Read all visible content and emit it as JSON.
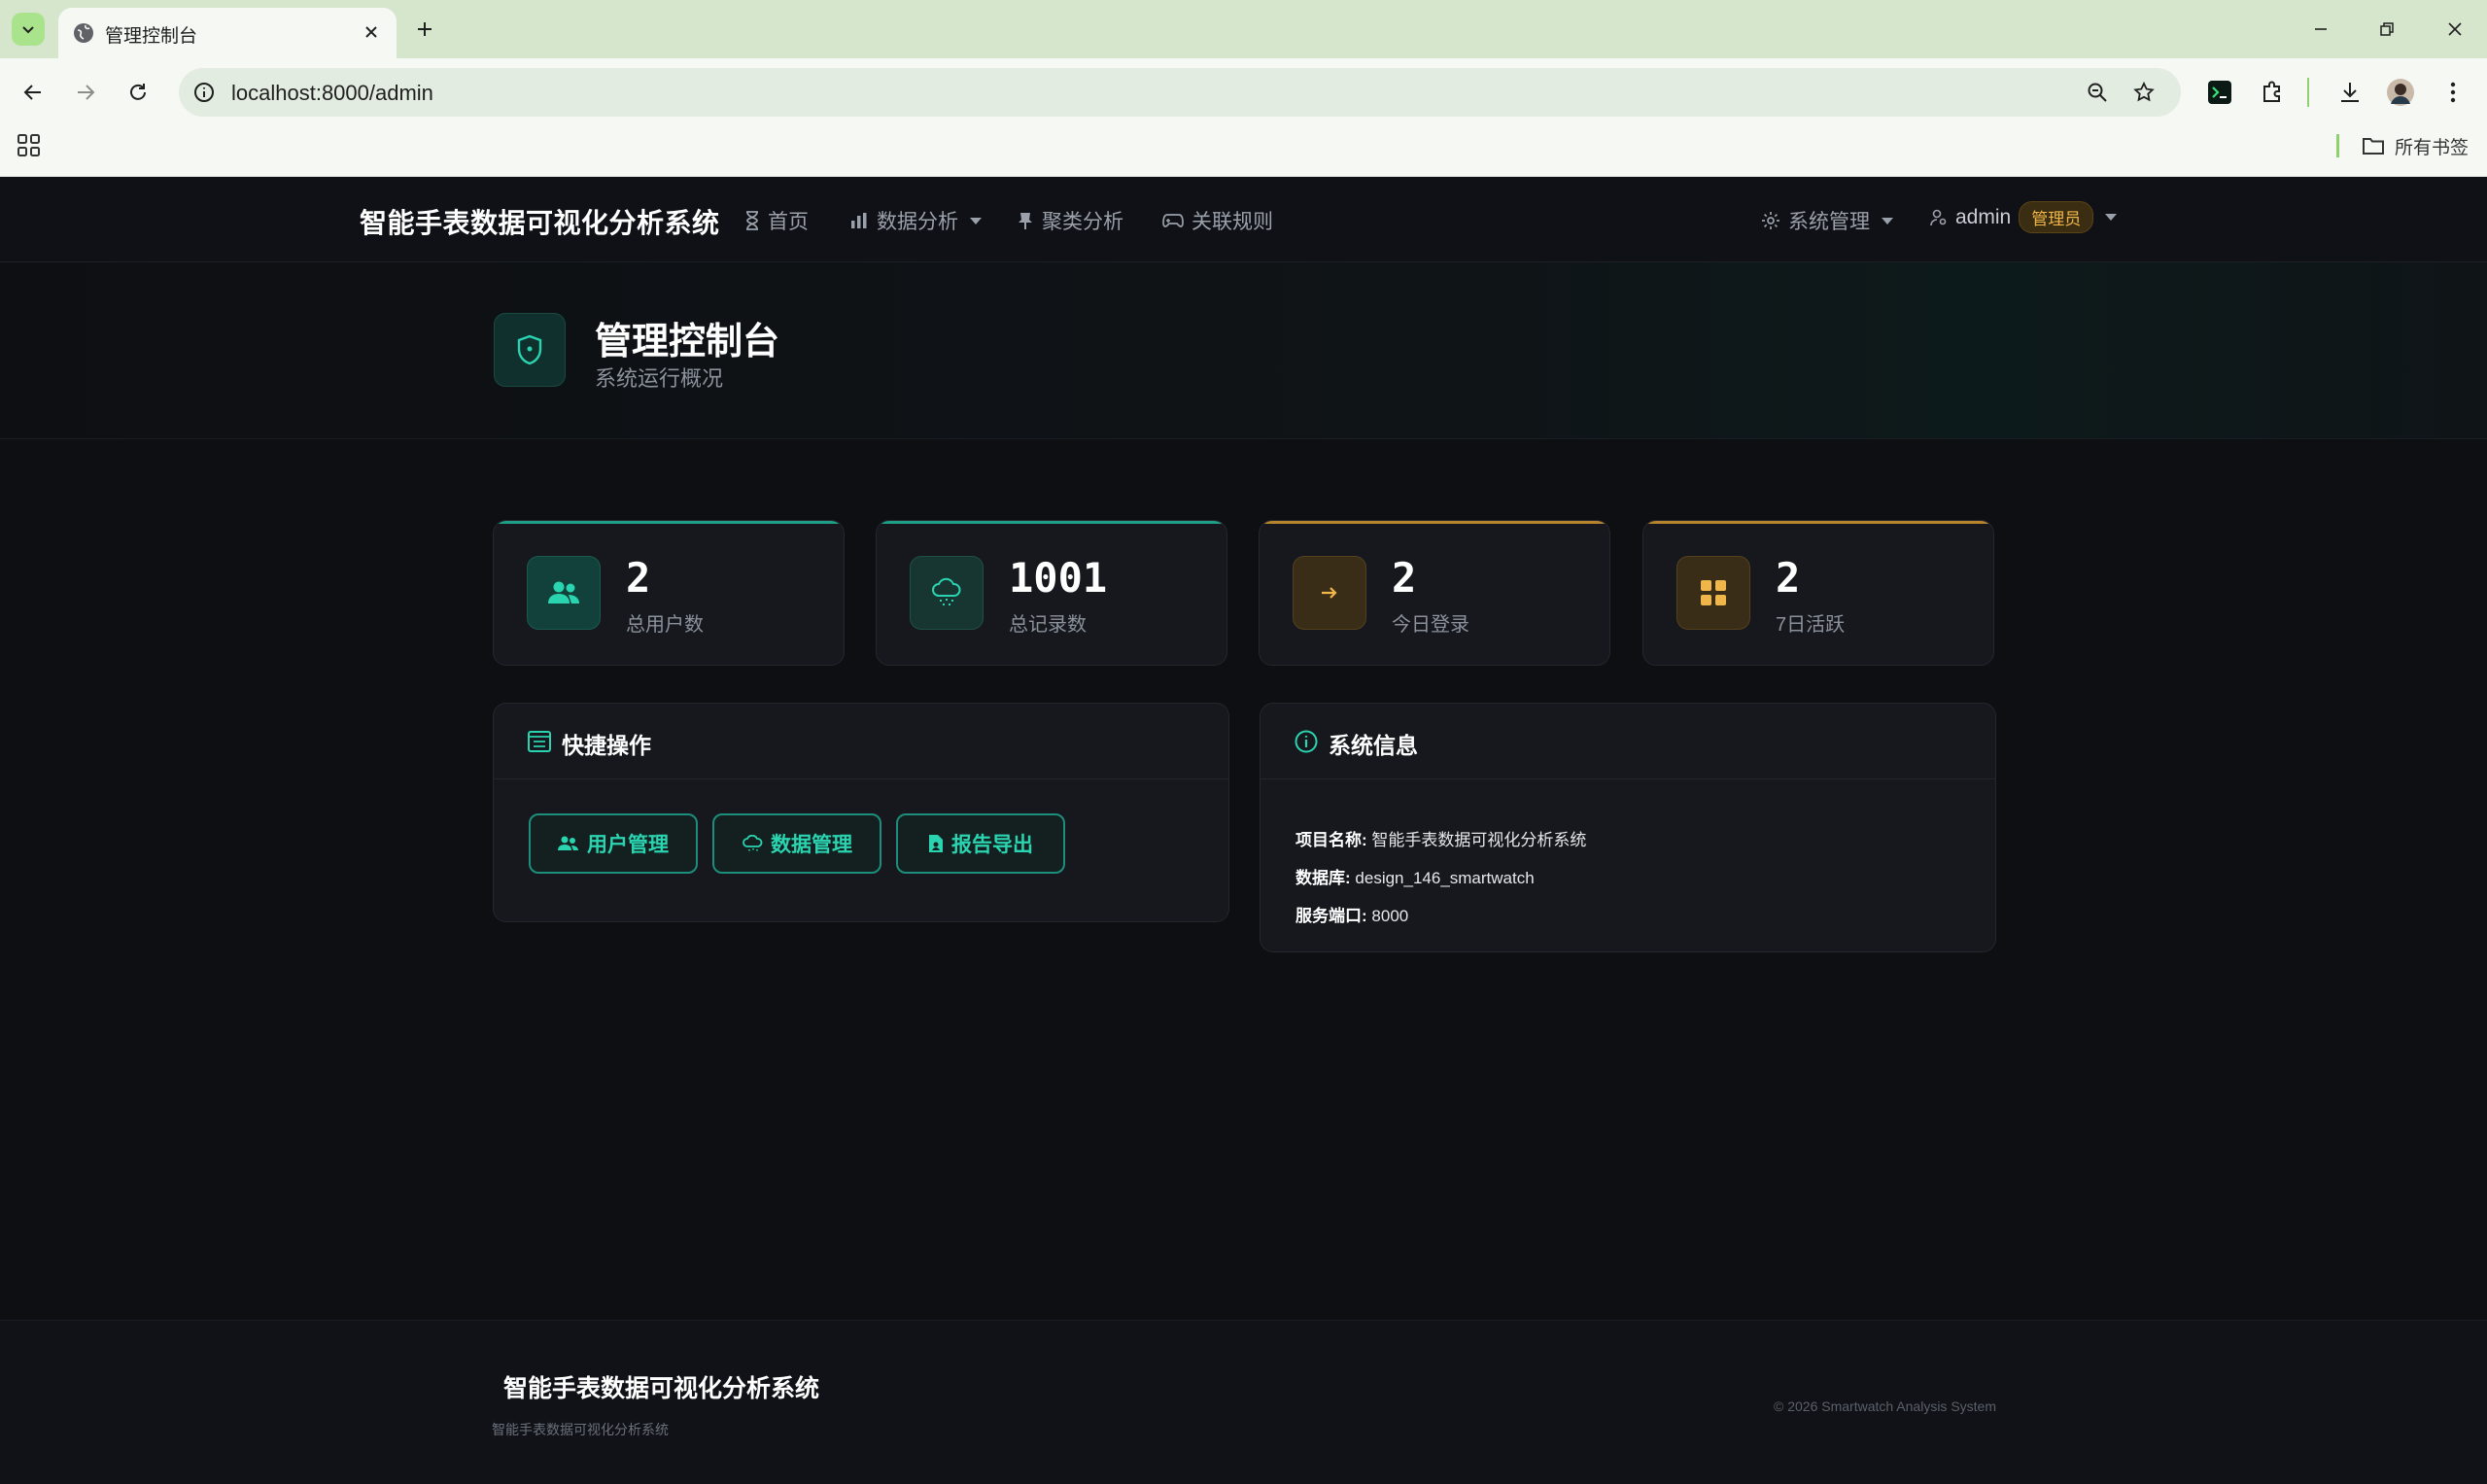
{
  "browser": {
    "tab_title": "管理控制台",
    "url": "localhost:8000/admin",
    "bookmarks_all": "所有书签"
  },
  "nav": {
    "brand": "智能手表数据可视化分析系统",
    "items": [
      {
        "label": "首页",
        "icon": "hourglass-icon"
      },
      {
        "label": "数据分析",
        "icon": "bar-chart-icon",
        "dropdown": true
      },
      {
        "label": "聚类分析",
        "icon": "pin-icon"
      },
      {
        "label": "关联规则",
        "icon": "gamepad-icon"
      }
    ],
    "system_menu": "系统管理",
    "user": "admin",
    "role_badge": "管理员"
  },
  "hero": {
    "title": "管理控制台",
    "subtitle": "系统运行概况"
  },
  "stats": [
    {
      "value": "2",
      "label": "总用户数",
      "icon": "users-icon",
      "accent": "#1fb89a"
    },
    {
      "value": "1001",
      "label": "总记录数",
      "icon": "cloud-rain-icon",
      "accent": "#1fb89a"
    },
    {
      "value": "2",
      "label": "今日登录",
      "icon": "arrow-right-icon",
      "accent": "#d79a35"
    },
    {
      "value": "2",
      "label": "7日活跃",
      "icon": "grid-icon",
      "accent": "#d79a35"
    }
  ],
  "quick_actions": {
    "title": "快捷操作",
    "buttons": [
      {
        "label": "用户管理",
        "icon": "users-icon"
      },
      {
        "label": "数据管理",
        "icon": "cloud-icon"
      },
      {
        "label": "报告导出",
        "icon": "file-icon"
      }
    ]
  },
  "system_info": {
    "title": "系统信息",
    "rows": [
      {
        "key": "项目名称:",
        "value": "智能手表数据可视化分析系统"
      },
      {
        "key": "数据库:",
        "value": "design_146_smartwatch"
      },
      {
        "key": "服务端口:",
        "value": "8000"
      }
    ]
  },
  "footer": {
    "brand": "智能手表数据可视化分析系统",
    "subtitle": "智能手表数据可视化分析系统",
    "copyright": "© 2026 Smartwatch Analysis System"
  },
  "colors": {
    "accent_teal": "#2ad4b0",
    "accent_gold": "#f0b64a",
    "background": "#0e0f13"
  }
}
